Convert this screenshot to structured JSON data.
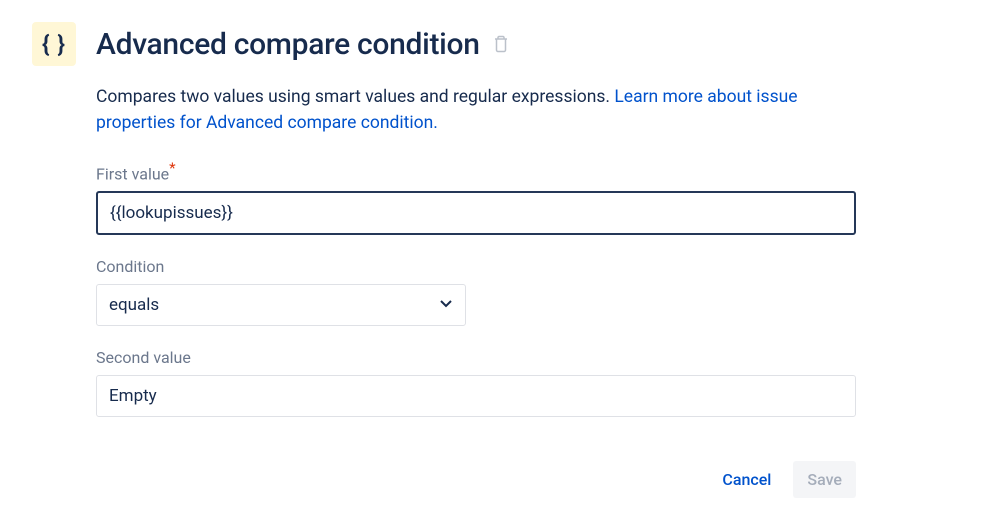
{
  "header": {
    "icon_glyph": "{ }",
    "title": "Advanced compare condition"
  },
  "description": {
    "text": "Compares two values using smart values and regular expressions. ",
    "link_text": "Learn more about issue properties for Advanced compare condition."
  },
  "form": {
    "first_value": {
      "label": "First value",
      "value": "{{lookupissues}}"
    },
    "condition": {
      "label": "Condition",
      "value": "equals"
    },
    "second_value": {
      "label": "Second value",
      "value": "Empty"
    }
  },
  "footer": {
    "cancel_label": "Cancel",
    "save_label": "Save"
  }
}
